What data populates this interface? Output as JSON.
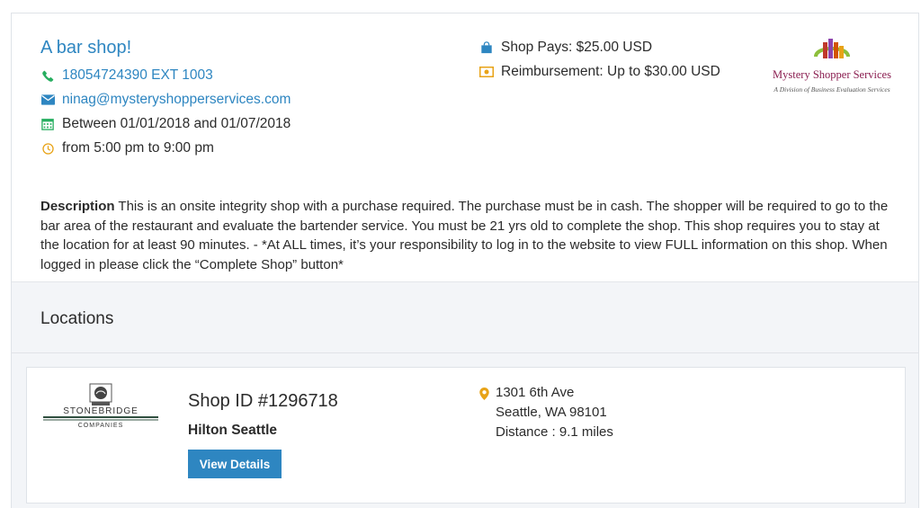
{
  "shop": {
    "title": "A bar shop!",
    "phone": "18054724390 EXT 1003",
    "email": "ninag@mysteryshopperservices.com",
    "dates": "Between 01/01/2018 and 01/07/2018",
    "time": "from 5:00 pm to 9:00 pm",
    "pays": "Shop Pays: $25.00 USD",
    "reimbursement": "Reimbursement: Up to $30.00 USD"
  },
  "company_logo": {
    "name": "Mystery Shopper Services",
    "subtitle": "A Division of Business Evaluation Services"
  },
  "description": {
    "label": "Description",
    "text": " This is an onsite integrity shop with a purchase required. The purchase must be in cash. The shopper will be required to go to the bar area of the restaurant and evaluate the bartender service. You must be 21 yrs old to complete the shop. This shop requires you to stay at the location for at least 90 minutes. - *At ALL times, it’s your responsibility to log in to the website to view FULL information on this shop. When logged in please click the “Complete Shop” button*"
  },
  "locations": {
    "heading": "Locations",
    "items": [
      {
        "logo_name": "STONEBRIDGE",
        "logo_sub": "COMPANIES",
        "shop_id": "Shop ID #1296718",
        "name": "Hilton Seattle",
        "button": "View Details",
        "address_line1": "1301 6th Ave",
        "address_line2": "Seattle, WA 98101",
        "distance": "Distance : 9.1 miles"
      }
    ]
  },
  "colors": {
    "link_blue": "#2e86c1",
    "icon_green": "#27ae60",
    "icon_orange": "#e8a317",
    "band_gray": "#f3f5f8"
  },
  "icons": {
    "phone": "phone-icon",
    "email": "envelope-icon",
    "dates": "calendar-icon",
    "time": "clock-icon",
    "pays": "shopping-bag-icon",
    "reimbursement": "money-bill-icon",
    "address": "map-pin-icon"
  }
}
